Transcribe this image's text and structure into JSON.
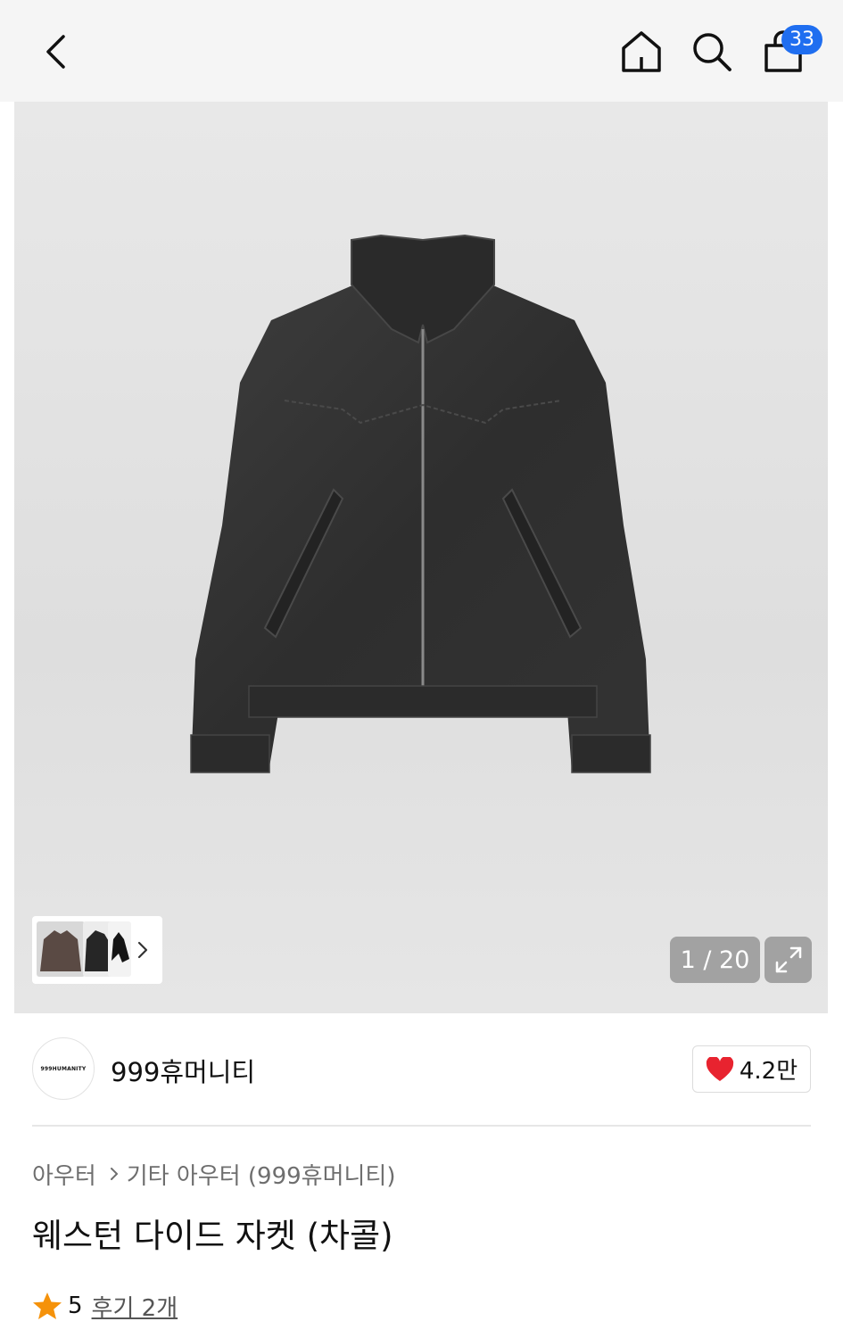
{
  "header": {
    "back_icon": "chevron-left-icon",
    "home_icon": "home-icon",
    "search_icon": "search-icon",
    "cart_icon": "shopping-bag-icon",
    "cart_count": "33",
    "badge_color": "#1f6ef0"
  },
  "gallery": {
    "page_counter": "1 / 20",
    "expand_icon": "expand-icon",
    "thumb_chevron_icon": "chevron-right-icon"
  },
  "brand": {
    "logo_text": "999HUMANITY",
    "name": "999휴머니티",
    "like_icon": "heart-icon",
    "like_color": "#e8232f",
    "like_count": "4.2만"
  },
  "breadcrumb": {
    "items": [
      "아우터",
      "기타 아우터 (999휴머니티)"
    ]
  },
  "product": {
    "title": "웨스턴 다이드 자켓 (차콜)"
  },
  "rating": {
    "star_icon": "star-icon",
    "star_color": "#f5920a",
    "value": "5",
    "review_link": "후기 2개"
  }
}
